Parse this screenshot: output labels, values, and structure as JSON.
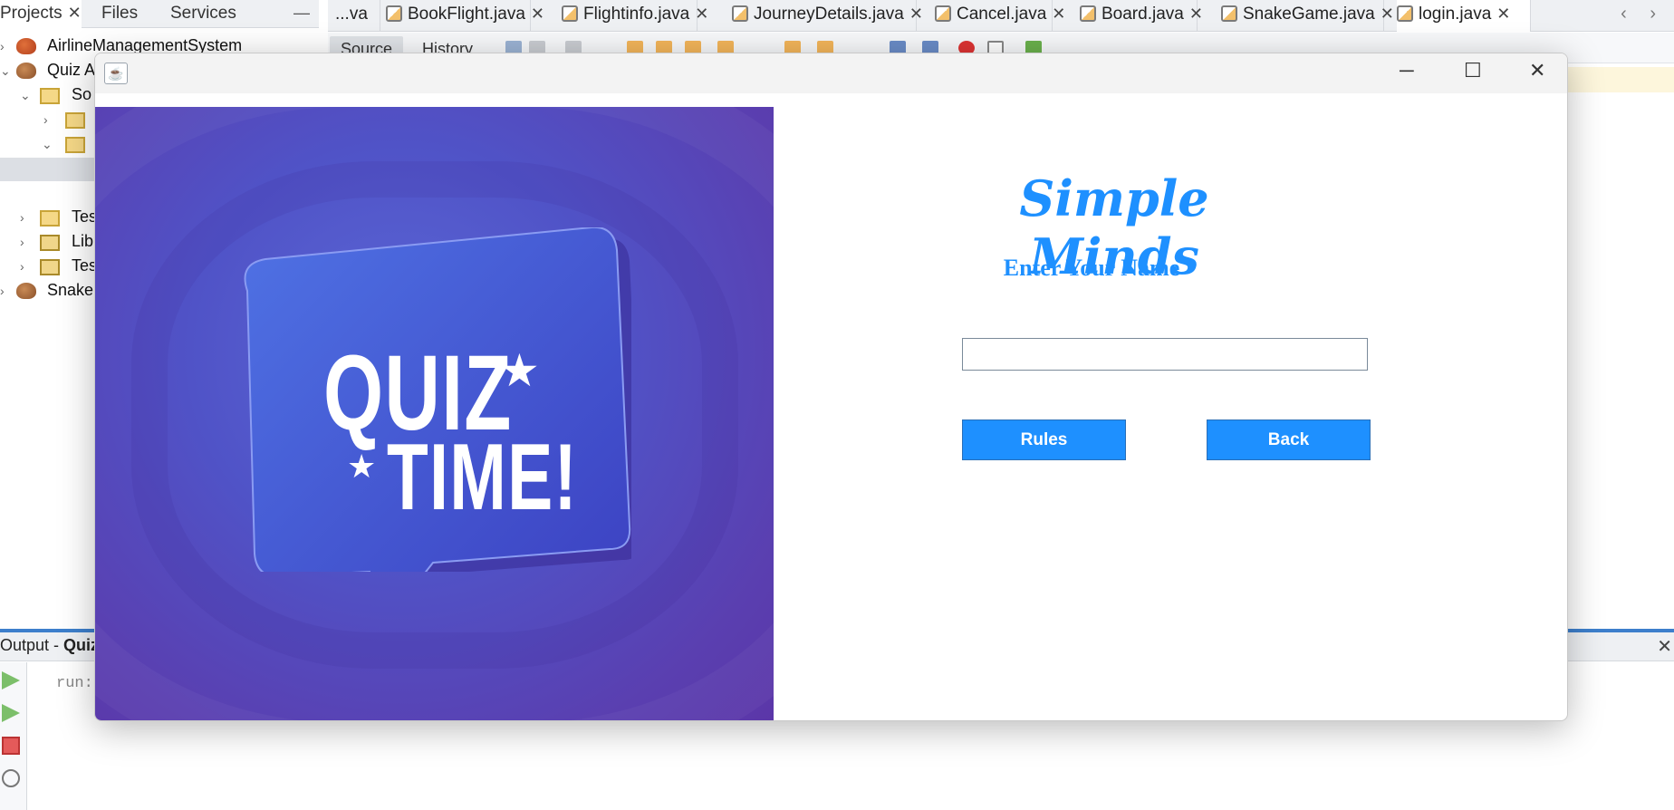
{
  "ide": {
    "left_tabs": {
      "projects": "Projects",
      "files": "Files",
      "services": "Services"
    },
    "tree": [
      {
        "label": "AirlineManagementSystem",
        "icon": "project-icon"
      },
      {
        "label": "Quiz A",
        "icon": "project-icon"
      },
      {
        "label": "So",
        "icon": "package-icon"
      },
      {
        "label": "",
        "icon": "package-icon"
      },
      {
        "label": "",
        "icon": "package-icon"
      },
      {
        "label": "Tes",
        "icon": "package-icon"
      },
      {
        "label": "Lib",
        "icon": "library-icon"
      },
      {
        "label": "Tes",
        "icon": "library-icon"
      },
      {
        "label": "Snake",
        "icon": "project-icon"
      }
    ],
    "editor_tabs": [
      "...va",
      "BookFlight.java",
      "Flightinfo.java",
      "JourneyDetails.java",
      "Cancel.java",
      "Board.java",
      "SnakeGame.java",
      "login.java"
    ],
    "active_tab": "login.java",
    "toolbar": {
      "source": "Source",
      "history": "History"
    },
    "output": {
      "title_prefix": "Output - ",
      "title_bold": "Quiz",
      "run_text": "run:"
    }
  },
  "window": {
    "title": "",
    "image": {
      "line1": "QUIZ",
      "line2": "TIME!"
    },
    "app_title": "Simple Minds",
    "prompt_label": "Enter Your Name",
    "name_input": {
      "value": "",
      "placeholder": ""
    },
    "rules_button": "Rules",
    "back_button": "Back"
  },
  "colors": {
    "accent": "#1e90ff",
    "quiz_bg": "#5b36a8",
    "bubble": "#4a5ad8"
  }
}
